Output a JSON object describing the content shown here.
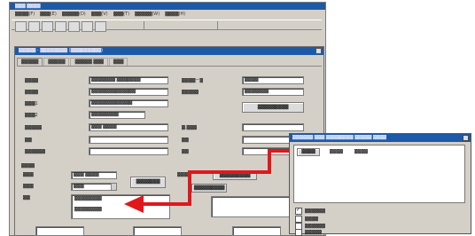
{
  "app": {
    "title": "▓▓▓ ▓▓▓▓",
    "menu": [
      "▓▓▓▓(F)",
      "▓▓▓(E)",
      "▓▓▓▓▓(D)",
      "▓▓▓(V)",
      "▓▓▓(T)",
      "▓▓▓▓▓(W)",
      "▓▓▓▓(H)"
    ]
  },
  "child": {
    "title": "▓▓▓▓▓ - ▓▓▓▓▓▓▓▓ (▓▓▓▓▓▓▓▓▓)",
    "tabs": [
      "▓▓▓▓▓",
      "▓▓▓▓▓",
      "▓▓▓▓▓ ▓▓▓",
      "▓▓▓"
    ]
  },
  "form": {
    "left_labels": [
      "▓▓▓▓",
      "▓▓▓▓",
      "▓▓▓1",
      "▓▓▓2",
      "▓▓▓▓▓",
      "▓▓",
      "▓▓▓▓▓▓"
    ],
    "left_values": [
      "▓▓▓▓▓▓▓ ▓▓▓▓▓▓▓",
      "▓▓▓▓▓▓▓▓▓▓▓▓▓",
      "▓▓▓▓▓▓▓▓▓▓▓▓",
      "▓▓▓▓▓▓▓▓",
      "▓▓▓ ▓▓▓▓",
      "",
      ""
    ],
    "right_labels": [
      "▓▓▓▓ー▓",
      "▓▓▓▓▓",
      "",
      "",
      "▓.▓▓▓",
      "▓▓",
      "▓▓"
    ],
    "right_values": [
      "▓▓▓▓",
      "▓▓▓▓▓▓▓",
      "",
      "",
      "",
      "",
      ""
    ],
    "search_button": "▓▓▓▓▓▓▓▓▓",
    "section_label": "▓▓▓▓",
    "bottom_labels": [
      "▓▓▓",
      "▓▓▓",
      "▓▓"
    ],
    "bottom_values": [
      "▓▓▓ ▓▓▓▓",
      "▓▓▓",
      ""
    ],
    "memo_line1": "▓▓▓▓▓▓▓▓",
    "memo_line2": "▓▓▓▓▓▓▓▓",
    "mid_button": "▓▓▓▓▓▓▓",
    "right2_labels": [
      "▓▓▓▓",
      "▓▓▓▓"
    ],
    "right2_buttons": [
      "▓▓▓▓▓▓▓▓▓",
      "▓▓▓▓▓▓▓▓▓"
    ]
  },
  "popup": {
    "title": "▓▓▓▓▓▓ ▓▓▓ ▓▓▓▓▓▓▓▓ ▓▓▓▓▓ ▓▓▓▓",
    "col_button": "▓▓▓▓",
    "col_headers": [
      "▓▓▓▓",
      "▓▓▓▓"
    ],
    "checks": [
      {
        "label": "▓▓▓▓▓▓",
        "checked": true
      },
      {
        "label": "▓▓▓▓",
        "checked": false
      },
      {
        "label": "▓▓▓▓▓▓",
        "checked": false
      },
      {
        "label": "▓▓▓▓▓",
        "checked": false
      }
    ]
  },
  "colors": {
    "titlebar": "#1c5aa8",
    "arrow": "#e0181c",
    "chrome": "#d4d0c8"
  }
}
